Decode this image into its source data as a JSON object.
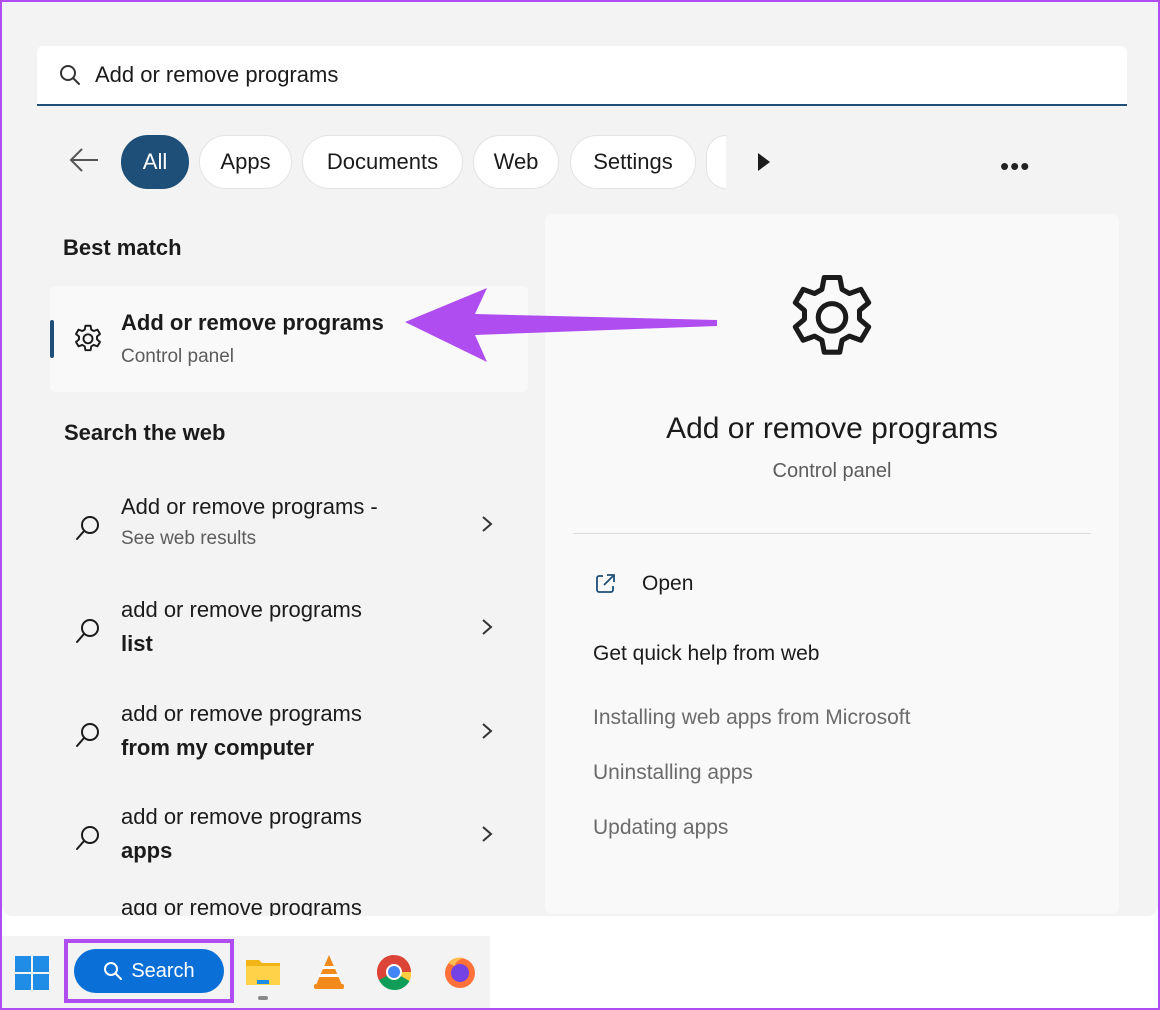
{
  "search": {
    "value": "Add or remove programs",
    "icon": "search-icon"
  },
  "filters": {
    "back_icon": "back-arrow-icon",
    "chips": [
      "All",
      "Apps",
      "Documents",
      "Web",
      "Settings"
    ],
    "active": "All",
    "more_icon": "more-icon"
  },
  "best_match": {
    "heading": "Best match",
    "title": "Add or remove programs",
    "subtitle": "Control panel",
    "icon": "gear-icon"
  },
  "web": {
    "heading": "Search the web",
    "results": [
      {
        "line1": "Add or remove programs -",
        "line2": "See web results"
      },
      {
        "line1": "add or remove programs",
        "line2": "list"
      },
      {
        "line1": "add or remove programs",
        "line2": "from my computer"
      },
      {
        "line1": "add or remove programs",
        "line2": "apps"
      }
    ],
    "partial_result": "add or remove programs"
  },
  "detail": {
    "title": "Add or remove programs",
    "subtitle": "Control panel",
    "open_label": "Open",
    "quick_help_label": "Get quick help from web",
    "links": [
      "Installing web apps from Microsoft",
      "Uninstalling apps",
      "Updating apps"
    ]
  },
  "taskbar": {
    "search_label": "Search",
    "apps": [
      "file-explorer-icon",
      "vlc-icon",
      "chrome-icon",
      "firefox-icon"
    ]
  },
  "colors": {
    "accent": "#1d4f78",
    "highlight": "#b04df0",
    "taskbar_search": "#0a6fd6"
  }
}
